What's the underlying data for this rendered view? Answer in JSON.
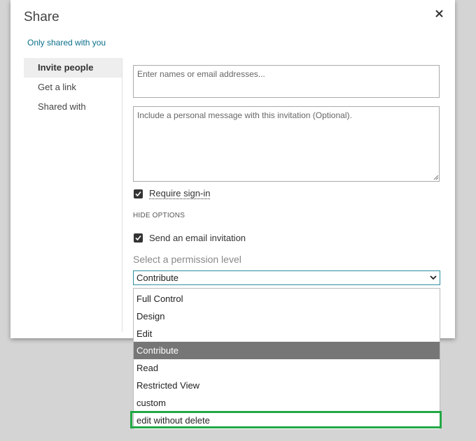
{
  "dialog": {
    "title": "Share",
    "subtitle": "Only shared with you"
  },
  "nav": {
    "items": [
      "Invite people",
      "Get a link",
      "Shared with"
    ],
    "active_index": 0
  },
  "form": {
    "names_placeholder": "Enter names or email addresses...",
    "message_placeholder": "Include a personal message with this invitation (Optional).",
    "require_signin_label": "Require sign-in",
    "require_signin_checked": true,
    "hide_options_label": "HIDE OPTIONS",
    "send_email_label": "Send an email invitation",
    "send_email_checked": true,
    "permission_label": "Select a permission level",
    "permission_selected": "Contribute"
  },
  "dropdown": {
    "options": [
      "Full Control",
      "Design",
      "Edit",
      "Contribute",
      "Read",
      "Restricted View",
      "custom",
      "edit without delete"
    ],
    "selected_index": 3,
    "highlighted_index": 7
  },
  "colors": {
    "accent": "#0a6f8a",
    "selected_bg": "#767676",
    "highlight": "#22a845"
  },
  "icons": {
    "close": "close-icon",
    "check": "checkmark-icon",
    "dropdown": "chevron-down-icon"
  }
}
